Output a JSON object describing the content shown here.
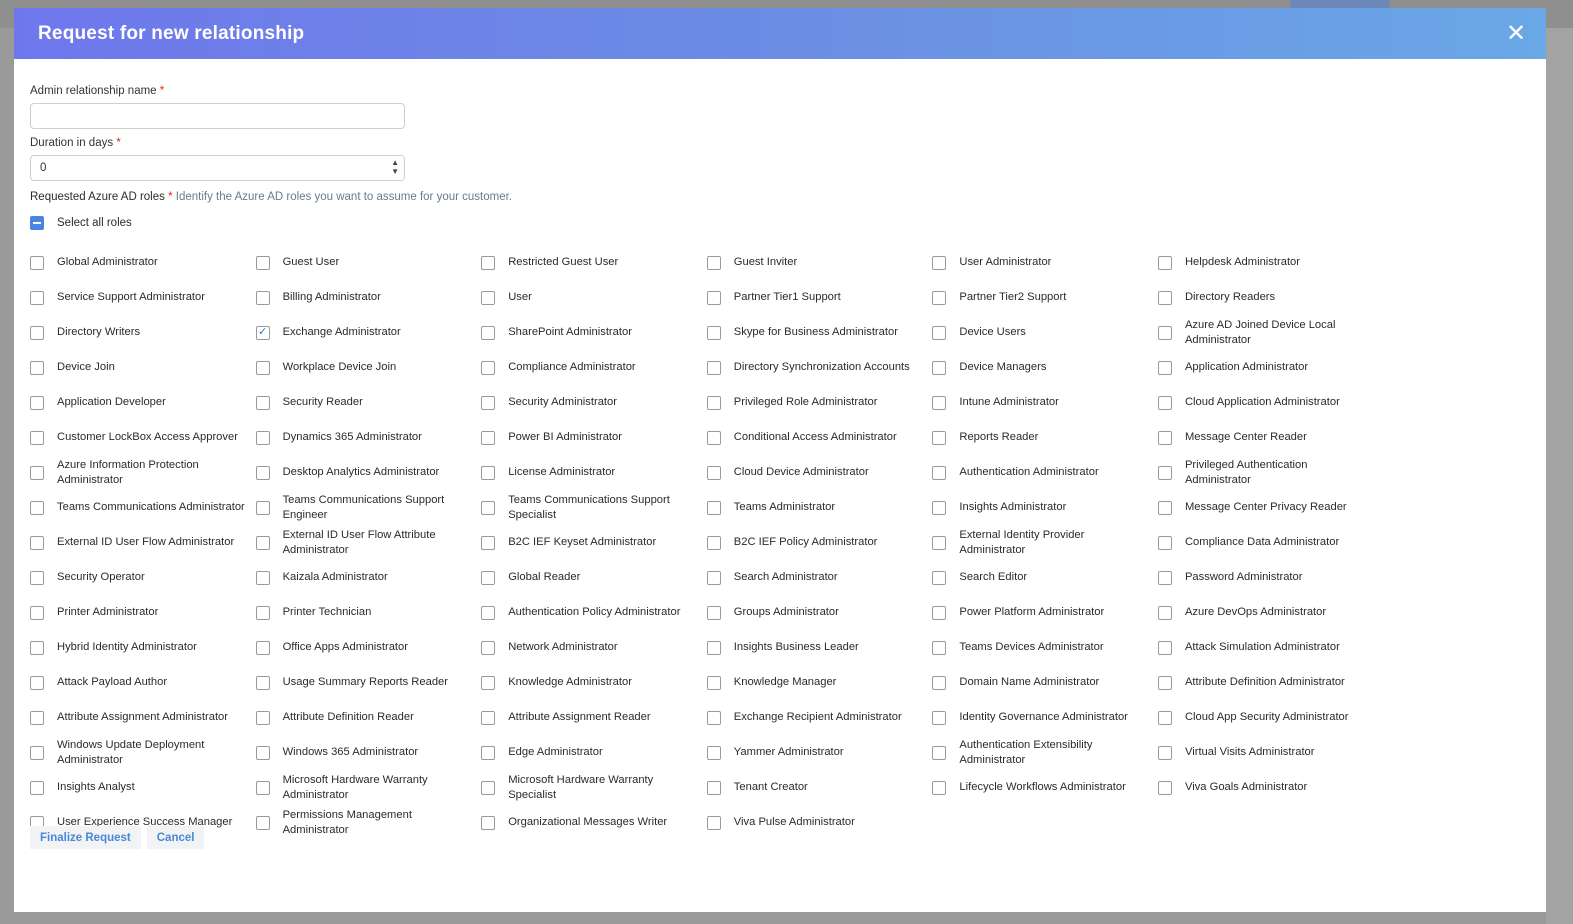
{
  "modal": {
    "title": "Request for new relationship",
    "close_glyph": "✕"
  },
  "form": {
    "name_label": "Admin relationship name",
    "name_value": "",
    "duration_label": "Duration in days",
    "duration_value": "0",
    "required_mark": "*",
    "roles_label": "Requested Azure AD roles",
    "roles_hint": "Identify the Azure AD roles you want to assume for your customer.",
    "select_all_label": "Select all roles",
    "select_all_state": "indeterminate"
  },
  "roles": [
    {
      "label": "Global Administrator",
      "checked": false
    },
    {
      "label": "Guest User",
      "checked": false
    },
    {
      "label": "Restricted Guest User",
      "checked": false
    },
    {
      "label": "Guest Inviter",
      "checked": false
    },
    {
      "label": "User Administrator",
      "checked": false
    },
    {
      "label": "Helpdesk Administrator",
      "checked": false
    },
    {
      "label": "Service Support Administrator",
      "checked": false
    },
    {
      "label": "Billing Administrator",
      "checked": false
    },
    {
      "label": "User",
      "checked": false
    },
    {
      "label": "Partner Tier1 Support",
      "checked": false
    },
    {
      "label": "Partner Tier2 Support",
      "checked": false
    },
    {
      "label": "Directory Readers",
      "checked": false
    },
    {
      "label": "Directory Writers",
      "checked": false
    },
    {
      "label": "Exchange Administrator",
      "checked": true
    },
    {
      "label": "SharePoint Administrator",
      "checked": false
    },
    {
      "label": "Skype for Business Administrator",
      "checked": false
    },
    {
      "label": "Device Users",
      "checked": false
    },
    {
      "label": "Azure AD Joined Device Local Administrator",
      "checked": false
    },
    {
      "label": "Device Join",
      "checked": false
    },
    {
      "label": "Workplace Device Join",
      "checked": false
    },
    {
      "label": "Compliance Administrator",
      "checked": false
    },
    {
      "label": "Directory Synchronization Accounts",
      "checked": false
    },
    {
      "label": "Device Managers",
      "checked": false
    },
    {
      "label": "Application Administrator",
      "checked": false
    },
    {
      "label": "Application Developer",
      "checked": false
    },
    {
      "label": "Security Reader",
      "checked": false
    },
    {
      "label": "Security Administrator",
      "checked": false
    },
    {
      "label": "Privileged Role Administrator",
      "checked": false
    },
    {
      "label": "Intune Administrator",
      "checked": false
    },
    {
      "label": "Cloud Application Administrator",
      "checked": false
    },
    {
      "label": "Customer LockBox Access Approver",
      "checked": false
    },
    {
      "label": "Dynamics 365 Administrator",
      "checked": false
    },
    {
      "label": "Power BI Administrator",
      "checked": false
    },
    {
      "label": "Conditional Access Administrator",
      "checked": false
    },
    {
      "label": "Reports Reader",
      "checked": false
    },
    {
      "label": "Message Center Reader",
      "checked": false
    },
    {
      "label": "Azure Information Protection Administrator",
      "checked": false
    },
    {
      "label": "Desktop Analytics Administrator",
      "checked": false
    },
    {
      "label": "License Administrator",
      "checked": false
    },
    {
      "label": "Cloud Device Administrator",
      "checked": false
    },
    {
      "label": "Authentication Administrator",
      "checked": false
    },
    {
      "label": "Privileged Authentication Administrator",
      "checked": false
    },
    {
      "label": "Teams Communications Administrator",
      "checked": false
    },
    {
      "label": "Teams Communications Support Engineer",
      "checked": false
    },
    {
      "label": "Teams Communications Support Specialist",
      "checked": false
    },
    {
      "label": "Teams Administrator",
      "checked": false
    },
    {
      "label": "Insights Administrator",
      "checked": false
    },
    {
      "label": "Message Center Privacy Reader",
      "checked": false
    },
    {
      "label": "External ID User Flow Administrator",
      "checked": false
    },
    {
      "label": "External ID User Flow Attribute Administrator",
      "checked": false
    },
    {
      "label": "B2C IEF Keyset Administrator",
      "checked": false
    },
    {
      "label": "B2C IEF Policy Administrator",
      "checked": false
    },
    {
      "label": "External Identity Provider Administrator",
      "checked": false
    },
    {
      "label": "Compliance Data Administrator",
      "checked": false
    },
    {
      "label": "Security Operator",
      "checked": false
    },
    {
      "label": "Kaizala Administrator",
      "checked": false
    },
    {
      "label": "Global Reader",
      "checked": false
    },
    {
      "label": "Search Administrator",
      "checked": false
    },
    {
      "label": "Search Editor",
      "checked": false
    },
    {
      "label": "Password Administrator",
      "checked": false
    },
    {
      "label": "Printer Administrator",
      "checked": false
    },
    {
      "label": "Printer Technician",
      "checked": false
    },
    {
      "label": "Authentication Policy Administrator",
      "checked": false
    },
    {
      "label": "Groups Administrator",
      "checked": false
    },
    {
      "label": "Power Platform Administrator",
      "checked": false
    },
    {
      "label": "Azure DevOps Administrator",
      "checked": false
    },
    {
      "label": "Hybrid Identity Administrator",
      "checked": false
    },
    {
      "label": "Office Apps Administrator",
      "checked": false
    },
    {
      "label": "Network Administrator",
      "checked": false
    },
    {
      "label": "Insights Business Leader",
      "checked": false
    },
    {
      "label": "Teams Devices Administrator",
      "checked": false
    },
    {
      "label": "Attack Simulation Administrator",
      "checked": false
    },
    {
      "label": "Attack Payload Author",
      "checked": false
    },
    {
      "label": "Usage Summary Reports Reader",
      "checked": false
    },
    {
      "label": "Knowledge Administrator",
      "checked": false
    },
    {
      "label": "Knowledge Manager",
      "checked": false
    },
    {
      "label": "Domain Name Administrator",
      "checked": false
    },
    {
      "label": "Attribute Definition Administrator",
      "checked": false
    },
    {
      "label": "Attribute Assignment Administrator",
      "checked": false
    },
    {
      "label": "Attribute Definition Reader",
      "checked": false
    },
    {
      "label": "Attribute Assignment Reader",
      "checked": false
    },
    {
      "label": "Exchange Recipient Administrator",
      "checked": false
    },
    {
      "label": "Identity Governance Administrator",
      "checked": false
    },
    {
      "label": "Cloud App Security Administrator",
      "checked": false
    },
    {
      "label": "Windows Update Deployment Administrator",
      "checked": false
    },
    {
      "label": "Windows 365 Administrator",
      "checked": false
    },
    {
      "label": "Edge Administrator",
      "checked": false
    },
    {
      "label": "Yammer Administrator",
      "checked": false
    },
    {
      "label": "Authentication Extensibility Administrator",
      "checked": false
    },
    {
      "label": "Virtual Visits Administrator",
      "checked": false
    },
    {
      "label": "Insights Analyst",
      "checked": false
    },
    {
      "label": "Microsoft Hardware Warranty Administrator",
      "checked": false
    },
    {
      "label": "Microsoft Hardware Warranty Specialist",
      "checked": false
    },
    {
      "label": "Tenant Creator",
      "checked": false
    },
    {
      "label": "Lifecycle Workflows Administrator",
      "checked": false
    },
    {
      "label": "Viva Goals Administrator",
      "checked": false
    },
    {
      "label": "User Experience Success Manager",
      "checked": false
    },
    {
      "label": "Permissions Management Administrator",
      "checked": false
    },
    {
      "label": "Organizational Messages Writer",
      "checked": false
    },
    {
      "label": "Viva Pulse Administrator",
      "checked": false
    }
  ],
  "footer": {
    "finalize_label": "Finalize Request",
    "cancel_label": "Cancel"
  },
  "colors": {
    "header_gradient_start": "#6f77ec",
    "header_gradient_end": "#6aa8e6",
    "accent": "#4a86e0",
    "required": "#e0261e"
  }
}
